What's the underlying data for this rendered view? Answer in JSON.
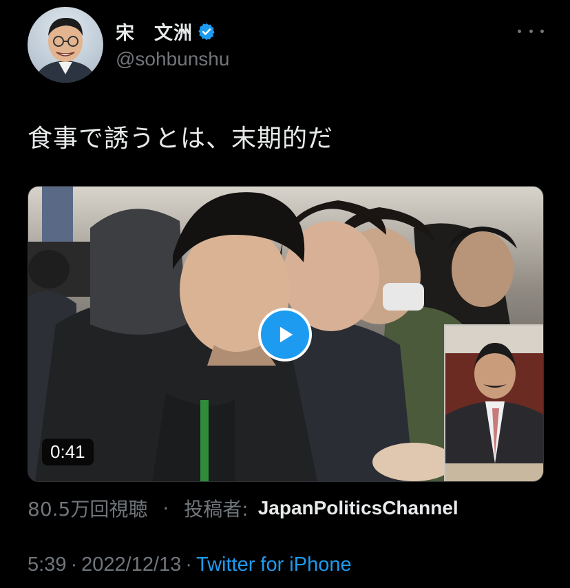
{
  "author": {
    "name": "宋　文洲",
    "handle": "@sohbunshu",
    "verified": true
  },
  "tweet": {
    "text": "食事で誘うとは、末期的だ"
  },
  "media": {
    "type": "video",
    "duration": "0:41"
  },
  "video_meta": {
    "views": "80.5万回視聴",
    "separator": "·",
    "poster_label": "投稿者:",
    "poster": "JapanPoliticsChannel"
  },
  "footer": {
    "time": "5:39",
    "date": "2022/12/13",
    "separator": "·",
    "source": "Twitter for iPhone"
  },
  "colors": {
    "background": "#000000",
    "text": "#e7e9ea",
    "muted": "#71767b",
    "accent": "#1d9bf0"
  },
  "icons": {
    "verified": "verified-badge-icon",
    "more": "more-horizontal-icon",
    "play": "play-icon"
  }
}
